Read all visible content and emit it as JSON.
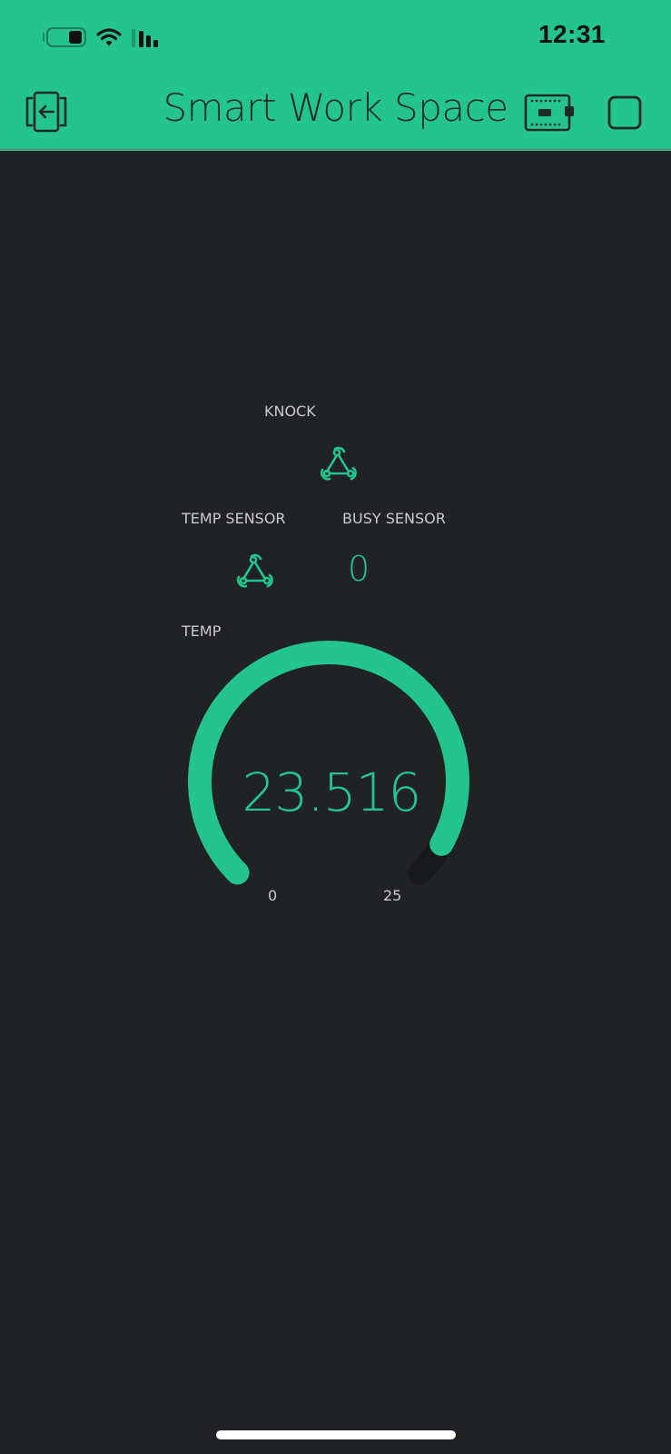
{
  "status_bar": {
    "time": "12:31",
    "icons": [
      "battery-icon",
      "wifi-icon",
      "cellular-signal-icon"
    ]
  },
  "app_bar": {
    "title": "Smart Work Space",
    "left_icon": "exit-app-icon",
    "right_icons": [
      "device-board-icon",
      "stop-square-icon"
    ]
  },
  "colors": {
    "accent": "#23c48e",
    "background": "#212226",
    "label": "#c9cbcd",
    "gauge_track": "#18191c"
  },
  "widgets": {
    "knock": {
      "label": "KNOCK",
      "icon": "webhook-icon"
    },
    "temp_sensor": {
      "label": "TEMP SENSOR",
      "icon": "webhook-icon"
    },
    "busy_sensor": {
      "label": "BUSY SENSOR",
      "value": "0"
    },
    "temp_gauge": {
      "label": "TEMP",
      "value": 23.516,
      "value_text": "23.516",
      "min": 0,
      "max": 25,
      "min_label": "0",
      "max_label": "25"
    }
  }
}
